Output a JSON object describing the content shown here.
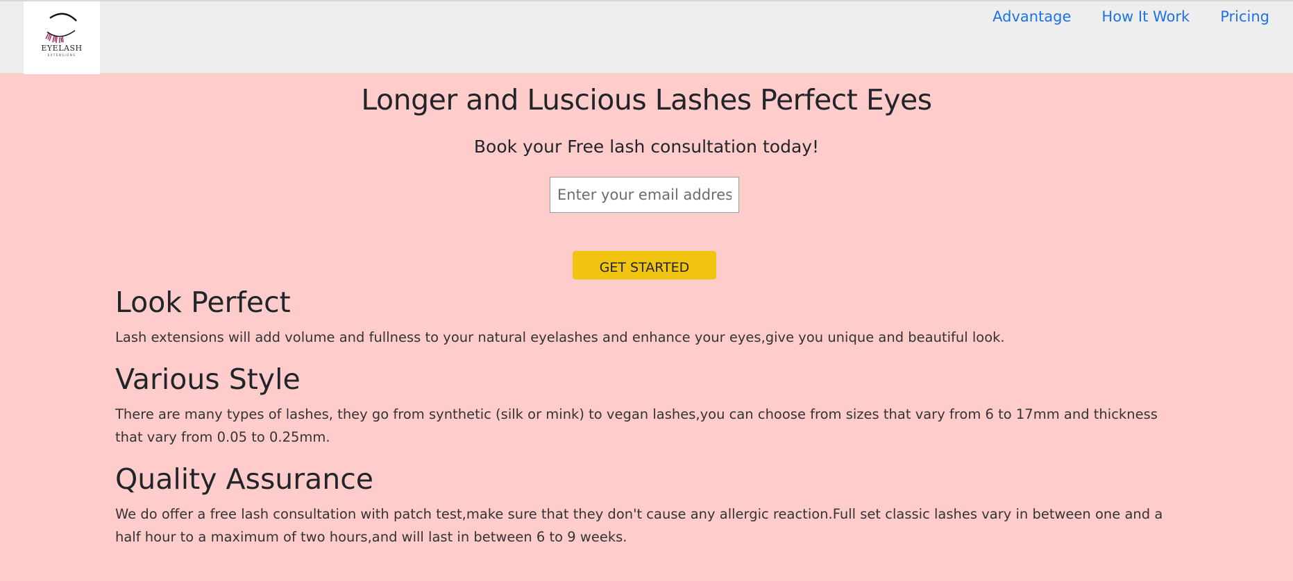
{
  "header": {
    "logo": {
      "word": "EYELASH",
      "sub": "EXTENSIONS"
    },
    "nav": [
      {
        "label": "Advantage"
      },
      {
        "label": "How It Work"
      },
      {
        "label": "Pricing"
      }
    ]
  },
  "hero": {
    "title": "Longer and Luscious Lashes Perfect Eyes",
    "subtitle": "Book your Free lash consultation today!",
    "email_placeholder": "Enter your email address",
    "cta_label": "GET STARTED"
  },
  "features": [
    {
      "title": "Look Perfect",
      "text": "Lash extensions will add volume and fullness to your natural eyelashes and enhance your eyes,give you unique and beautiful look."
    },
    {
      "title": "Various Style",
      "text": "There are many types of lashes, they go from synthetic (silk or mink) to vegan lashes,you can choose from sizes that vary from 6 to 17mm and thickness that vary from 0.05 to 0.25mm."
    },
    {
      "title": "Quality Assurance",
      "text": "We do offer a free lash consultation with patch test,make sure that they don't cause any allergic reaction.Full set classic lashes vary in between one and a half hour to a maximum of two hours,and will last in between 6 to 9 weeks."
    }
  ],
  "colors": {
    "page_background": "#ffcccc",
    "header_background": "#eeeeee",
    "nav_link": "#1a73e8",
    "cta_background": "#f1c40f"
  }
}
